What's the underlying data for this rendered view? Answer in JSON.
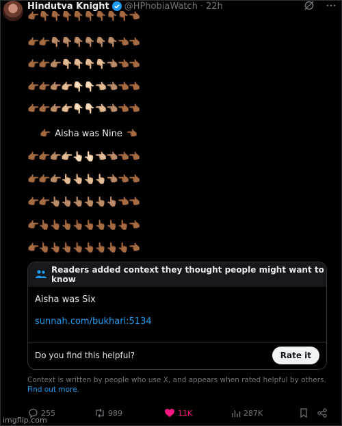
{
  "post": {
    "author_name": "Hindutva Knight",
    "handle": "@HPhobiaWatch",
    "separator": "·",
    "time": "22h",
    "rows": [
      "👉🏾👇🏾👇🏾👇🏾👇🏾👇🏾👇🏾👇🏾👇🏾👈🏾",
      "👉🏾👉🏾👇🏽👇🏽👇🏽👇🏽👇🏽👇🏽👈🏾👈🏾",
      "👉🏾👉🏾👉🏽👇🏼👇🏼👇🏼👇🏼👈🏽👈🏾👈🏾",
      "👉🏾👉🏾👉🏽👉🏼👇🏻👇🏻👈🏼👈🏽👈🏾👈🏾",
      "👉🏾👉🏾👉🏽👉🏼👆🏻👆🏻👈🏼👈🏽👈🏾👈🏾",
      "👉🏾👉🏾👉🏽👆🏼👆🏼👆🏼👆🏼👈🏽👈🏾👈🏾",
      "👉🏾👉🏾👆🏽👆🏽👆🏽👆🏽👆🏽👆🏽👈🏾👈🏾",
      "👉🏾👆🏾👆🏾👆🏾👆🏾👆🏾👆🏾👆🏾👆🏾👈🏾",
      "👉🏾👆🏾👆🏾👆🏾👆🏾👆🏾👆🏾👆🏾👆🏾👈🏾"
    ],
    "center_left": "👉🏾",
    "center_text": "Aisha was Nine",
    "center_right": "👈🏾"
  },
  "note": {
    "header": "Readers added context they thought people might want to know",
    "text": "Aisha was Six",
    "link": "sunnah.com/bukhari:5134",
    "question": "Do you find this helpful?",
    "rate_label": "Rate it"
  },
  "context": {
    "text": "Context is written by people who use X, and appears when rated helpful by others.",
    "link": "Find out more."
  },
  "actions": {
    "replies": "255",
    "reposts": "989",
    "likes": "11K",
    "views": "287K"
  },
  "watermark": "imgflip.com",
  "colors": {
    "accent": "#1d9bf0",
    "like": "#f91880",
    "muted": "#71767b"
  }
}
